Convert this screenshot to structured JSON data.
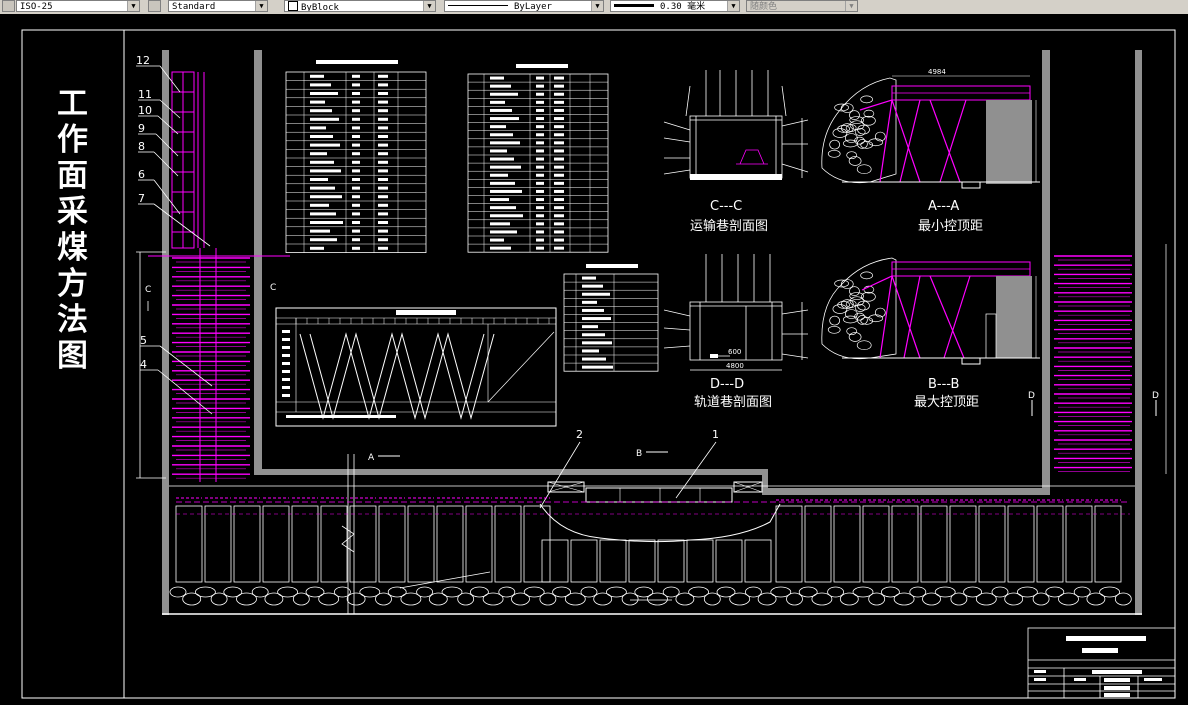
{
  "toolbar": {
    "dimstyle": "ISO-25",
    "textstyle": "Standard",
    "color": "ByBlock",
    "linetype": "ByLayer",
    "lineweight": "0.30 毫米",
    "plotstyle": "随颜色"
  },
  "drawing": {
    "vertical_title": [
      "工",
      "作",
      "面",
      "采",
      "煤",
      "方",
      "法",
      "图"
    ],
    "callouts": [
      "12",
      "11",
      "10",
      "9",
      "8",
      "6",
      "7",
      "5",
      "4",
      "2",
      "1"
    ],
    "section_cc": "C---C",
    "section_cc_name": "运输巷剖面图",
    "section_aa": "A---A",
    "section_aa_name": "最小控顶距",
    "section_dd": "D---D",
    "section_dd_name": "轨道巷剖面图",
    "section_bb": "B---B",
    "section_bb_name": "最大控顶距",
    "dim_aa_width": "4984",
    "dim_dd_inner": "600",
    "dim_dd_width": "4800",
    "marker_a": "A",
    "marker_b": "B",
    "marker_c": "C",
    "marker_d": "D"
  },
  "colors": {
    "background": "#000000",
    "linework": "#ffffff",
    "magenta": "#ff00ff",
    "support": "#d000d0",
    "grey": "#909090"
  }
}
